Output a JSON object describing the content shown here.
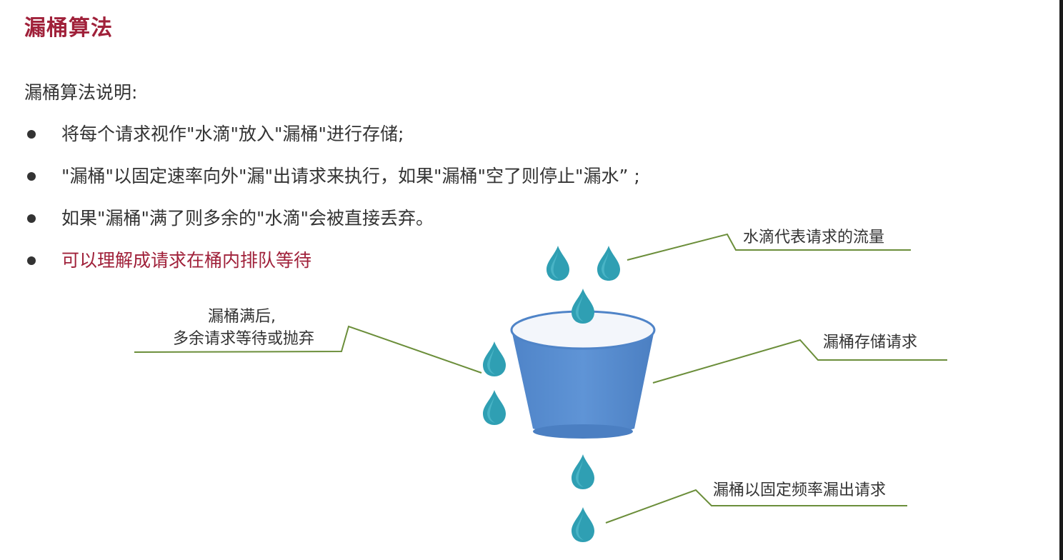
{
  "slide": {
    "title": "漏桶算法",
    "subtitle": "漏桶算法说明:",
    "bullets": [
      "将每个请求视作\"水滴\"放入\"漏桶\"进行存储;",
      "\"漏桶\"以固定速率向外\"漏\"出请求来执行，如果\"漏桶\"空了则停止\"漏水”  ;",
      "如果\"漏桶\"满了则多余的\"水滴\"会被直接丢弃。",
      "可以理解成请求在桶内排队等待"
    ]
  },
  "diagram": {
    "callouts": {
      "droplets": "水滴代表请求的流量",
      "overflow_line1": "漏桶满后,",
      "overflow_line2": "多余请求等待或抛弃",
      "storage": "漏桶存储请求",
      "rate": "漏桶以固定频率漏出请求"
    }
  },
  "colors": {
    "title": "#a0213a",
    "highlight": "#a0213a",
    "bucket": "#5b8fd0",
    "bucket_rim": "#f3f6fb",
    "droplet": "#2f9fb3",
    "leader_line": "#6b8e3a"
  }
}
